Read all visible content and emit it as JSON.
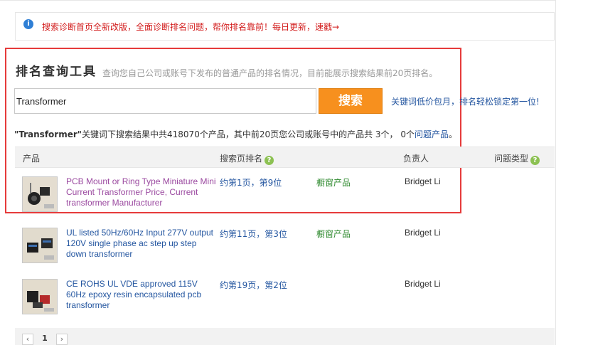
{
  "notice": {
    "text": "搜索诊断首页全新改版，全面诊断排名问题，帮你排名靠前！每日更新，速戳→"
  },
  "tool": {
    "title": "排名查询工具",
    "subtitle": "查询您自己公司或账号下发布的普通产品的排名情况，目前能展示搜索结果前20页排名。"
  },
  "search": {
    "value": "Transformer",
    "button_label": "搜索"
  },
  "promo": {
    "part1": "关键词低价包月",
    "sep": "，",
    "part2": "排名轻松锁定第一位!"
  },
  "summary": {
    "keyword": "\"Transformer\"",
    "text1": "关键词下搜索结果中共418070个产品，其中前20页您公司或账号中的产品共 3个，",
    "count": "0个",
    "link": "问题产品",
    "end": "。"
  },
  "table": {
    "headers": {
      "product": "产品",
      "rank": "搜索页排名",
      "owner": "负责人",
      "issue_type": "问题类型"
    },
    "rows": [
      {
        "name": "PCB Mount or Ring Type Miniature Mini Current Transformer Price, Current transformer Manufacturer",
        "rank": "约第1页，第9位",
        "type": "橱窗产品",
        "owner": "Bridget Li",
        "visited": true
      },
      {
        "name": "UL listed 50Hz/60Hz Input 277V output 120V single phase ac step up step down transformer",
        "rank": "约第11页，第3位",
        "type": "橱窗产品",
        "owner": "Bridget Li",
        "visited": false
      },
      {
        "name": "CE ROHS UL VDE approved 115V 60Hz epoxy resin encapsulated pcb transformer",
        "rank": "约第19页，第2位",
        "type": "",
        "owner": "Bridget Li",
        "visited": false
      }
    ]
  },
  "pagination": {
    "prev": "‹",
    "page": "1",
    "next": "›"
  },
  "colors": {
    "accent": "#f7901e",
    "highlight": "#e63b3b",
    "link": "#2456a0",
    "visited_link": "#9b4aa0",
    "green": "#2f8a2f",
    "notice_red": "#d21b1b"
  }
}
